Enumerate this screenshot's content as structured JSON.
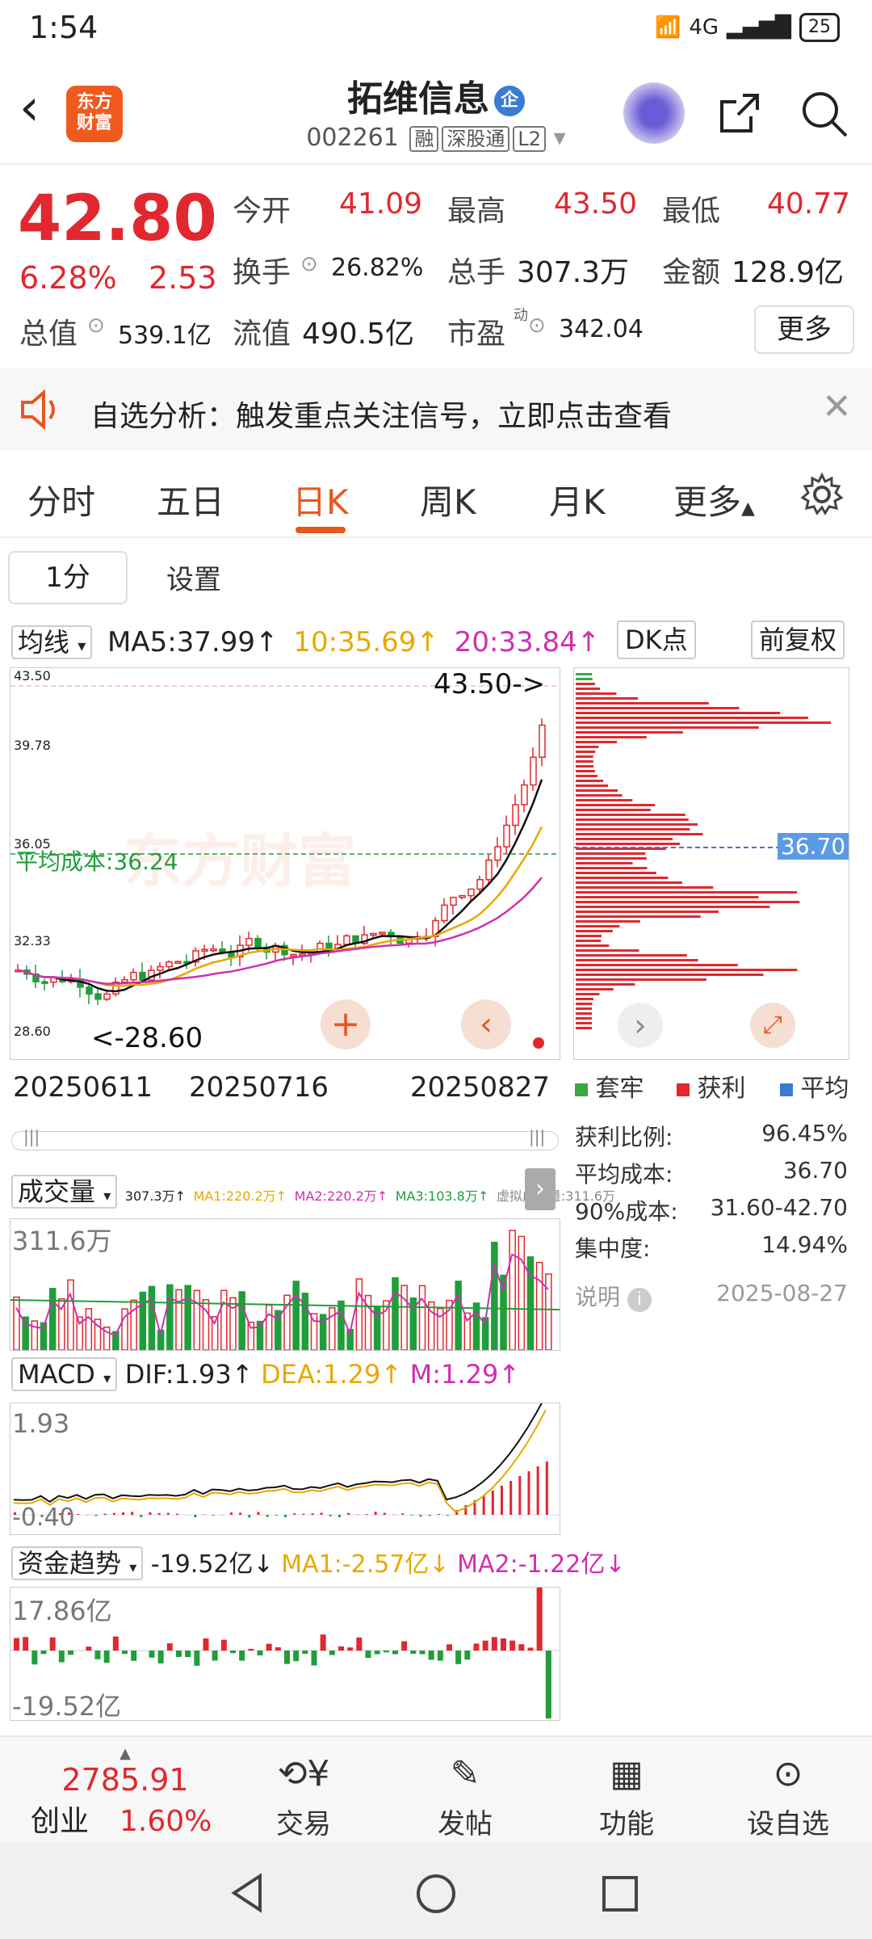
{
  "status": {
    "time": "1:54",
    "network": "4G",
    "battery": "25"
  },
  "header": {
    "logo_line1": "东方",
    "logo_line2": "财富",
    "stock_name": "拓维信息",
    "name_tag": "企",
    "stock_code": "002261",
    "badges": [
      "融",
      "深股通",
      "L2"
    ]
  },
  "quote": {
    "price": "42.80",
    "change_pct": "6.28%",
    "change_amt": "2.53",
    "open_label": "今开",
    "open": "41.09",
    "high_label": "最高",
    "high": "43.50",
    "low_label": "最低",
    "low": "40.77",
    "turnover_label": "换手",
    "turnover": "26.82%",
    "volume_label": "总手",
    "volume": "307.3万",
    "amount_label": "金额",
    "amount": "128.9亿",
    "mktcap_label": "总值",
    "mktcap": "539.1亿",
    "float_label": "流值",
    "float": "490.5亿",
    "pe_label": "市盈",
    "pe_sup": "动",
    "pe": "342.04",
    "more": "更多"
  },
  "notice": {
    "text": "自选分析：触发重点关注信号，立即点击查看"
  },
  "tabs": [
    "分时",
    "五日",
    "日K",
    "周K",
    "月K",
    "更多"
  ],
  "active_tab": "日K",
  "sub_buttons": {
    "period": "1分",
    "settings": "设置"
  },
  "ma": {
    "label": "均线",
    "ma5": "MA5:37.99↑",
    "ma10": "10:35.69↑",
    "ma20": "20:33.84↑"
  },
  "chart_controls": {
    "dk": "DK点",
    "fq": "前复权"
  },
  "kline": {
    "y_labels": [
      "43.50",
      "39.78",
      "36.05",
      "32.33",
      "28.60"
    ],
    "high_marker": "43.50->",
    "low_marker": "<-28.60",
    "cost_line": "平均成本:36.24",
    "watermark": "东方财富",
    "dates": [
      "20250611",
      "20250716",
      "20250827"
    ]
  },
  "distribution": {
    "price_tag": "36.70",
    "legend": [
      "套牢",
      "获利",
      "平均"
    ],
    "stats": [
      {
        "label": "获利比例:",
        "value": "96.45%"
      },
      {
        "label": "平均成本:",
        "value": "36.70"
      },
      {
        "label": "90%成本:",
        "value": "31.60-42.70"
      },
      {
        "label": "集中度:",
        "value": "14.94%"
      }
    ],
    "note": "说明",
    "date": "2025-08-27"
  },
  "volume": {
    "label": "成交量",
    "summary": "307.3万↑",
    "ma1": "MA1:220.2万↑",
    "ma2": "MA2:220.2万↑",
    "ma3": "MA3:103.8万↑",
    "virtual": "虚拟成交量:311.6万",
    "y_top": "311.6万"
  },
  "macd": {
    "label": "MACD",
    "dif": "DIF:1.93↑",
    "dea": "DEA:1.29↑",
    "m": "M:1.29↑",
    "y_top": "1.93",
    "y_bottom": "-0.40"
  },
  "fund": {
    "label": "资金趋势",
    "val": "-19.52亿↓",
    "ma1": "MA1:-2.57亿↓",
    "ma2": "MA2:-1.22亿↓",
    "y_top": "17.86亿",
    "y_bottom": "-19.52亿"
  },
  "bottom": {
    "index_value": "2785.91",
    "index_name": "创业",
    "index_pct": "1.60%",
    "items": [
      "交易",
      "发帖",
      "功能",
      "设自选"
    ]
  },
  "colors": {
    "up": "#e0282e",
    "down": "#1f9e3a",
    "accent": "#e8571e",
    "ma10": "#e8a800",
    "ma20": "#d02fb0"
  }
}
